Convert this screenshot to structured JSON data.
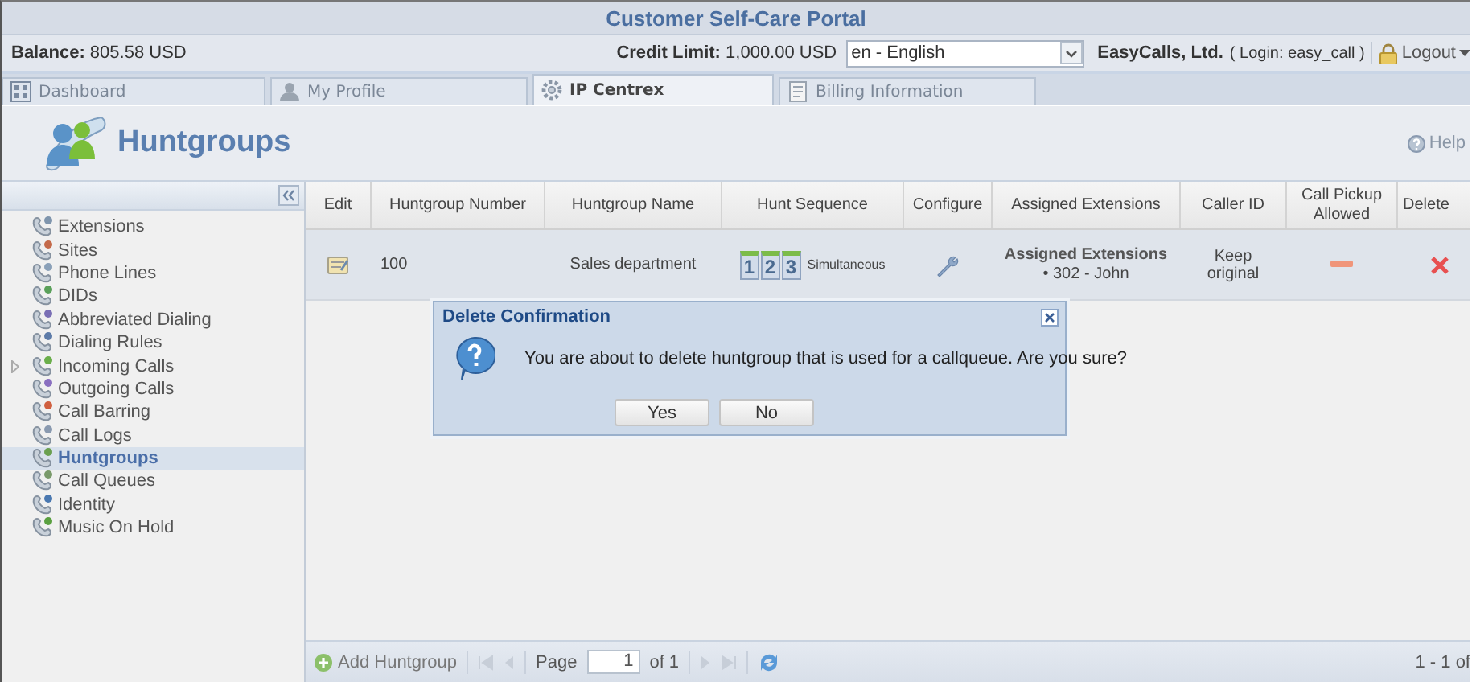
{
  "title": "Customer Self-Care Portal",
  "info_bar": {
    "balance_label": "Balance:",
    "balance_value": "805.58 USD",
    "credit_label": "Credit Limit:",
    "credit_value": "1,000.00 USD",
    "language": "en - English",
    "company": "EasyCalls, Ltd.",
    "login_open": "(",
    "login_label": "Login:",
    "login_value": "easy_call",
    "login_close": ")",
    "logout": "Logout"
  },
  "tabs": [
    {
      "label": "Dashboard",
      "selected": false
    },
    {
      "label": "My Profile",
      "selected": false
    },
    {
      "label": "IP Centrex",
      "selected": true
    },
    {
      "label": "Billing Information",
      "selected": false
    }
  ],
  "page_title": "Huntgroups",
  "help": "Help",
  "sidebar": {
    "items": [
      {
        "label": "Extensions",
        "kind": "leaf",
        "selected": false
      },
      {
        "label": "Sites",
        "kind": "leaf",
        "selected": false
      },
      {
        "label": "Phone Lines",
        "kind": "leaf",
        "selected": false
      },
      {
        "label": "DIDs",
        "kind": "leaf",
        "selected": false
      },
      {
        "label": "Abbreviated Dialing",
        "kind": "leaf",
        "selected": false
      },
      {
        "label": "Dialing Rules",
        "kind": "leaf",
        "selected": false
      },
      {
        "label": "Incoming Calls",
        "kind": "folder",
        "selected": false
      },
      {
        "label": "Outgoing Calls",
        "kind": "leaf",
        "selected": false
      },
      {
        "label": "Call Barring",
        "kind": "leaf",
        "selected": false
      },
      {
        "label": "Call Logs",
        "kind": "leaf",
        "selected": false
      },
      {
        "label": "Huntgroups",
        "kind": "leaf",
        "selected": true
      },
      {
        "label": "Call Queues",
        "kind": "leaf",
        "selected": false
      },
      {
        "label": "Identity",
        "kind": "leaf",
        "selected": false
      },
      {
        "label": "Music On Hold",
        "kind": "leaf",
        "selected": false
      }
    ]
  },
  "table": {
    "columns": [
      "Edit",
      "Huntgroup Number",
      "Huntgroup Name",
      "Hunt Sequence",
      "Configure",
      "Assigned Extensions",
      "Caller ID",
      "Call Pickup Allowed",
      "Delete"
    ],
    "rows": [
      {
        "number": "100",
        "name": "Sales department",
        "hunt_sequence": [
          "1",
          "2",
          "3"
        ],
        "hunt_mode": "Simultaneous",
        "assigned_title": "Assigned Extensions",
        "assigned_items": [
          "• 302 - John"
        ],
        "caller_id": "Keep original",
        "call_pickup_allowed": false
      }
    ]
  },
  "dialog": {
    "title": "Delete Confirmation",
    "message": "You are about to delete huntgroup that is used for a callqueue. Are you sure?",
    "buttons": [
      "Yes",
      "No"
    ]
  },
  "footer": {
    "add_button": "Add Huntgroup",
    "page_label": "Page",
    "page_value": "1",
    "page_of": "of 1",
    "range": "1 - 1 of"
  }
}
